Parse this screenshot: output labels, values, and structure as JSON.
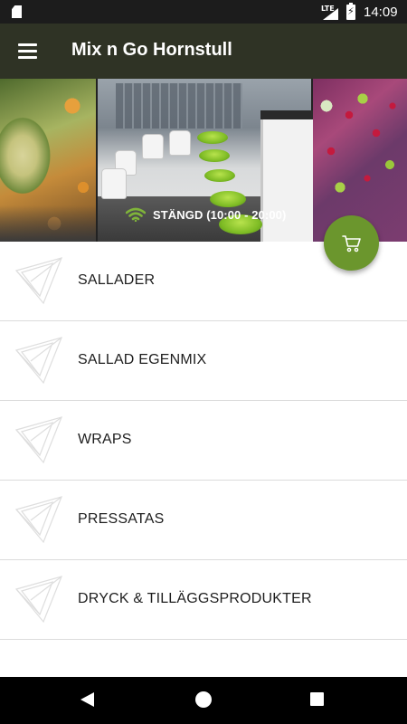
{
  "status_bar": {
    "network": "LTE",
    "time": "14:09",
    "icons": [
      "sd-card-icon",
      "signal-icon",
      "battery-charging-icon"
    ]
  },
  "app_bar": {
    "title": "Mix n Go Hornstull",
    "menu_icon": "hamburger-menu-icon"
  },
  "hero": {
    "status_text": "STÄNGD (10:00 - 20:00)",
    "status_icon": "wifi-icon",
    "status_icon_color": "#7fb43a"
  },
  "fab": {
    "icon": "shopping-cart-icon",
    "color": "#6b962d"
  },
  "menu": {
    "items": [
      {
        "label": "SALLADER"
      },
      {
        "label": "SALLAD EGENMIX"
      },
      {
        "label": "WRAPS"
      },
      {
        "label": "PRESSATAS"
      },
      {
        "label": "DRYCK & TILLÄGGSPRODUKTER"
      }
    ]
  },
  "nav_bar": {
    "icons": [
      "back-icon",
      "home-icon",
      "recent-apps-icon"
    ]
  },
  "colors": {
    "app_bar": "#2f3325",
    "status_bar": "#1c1c1c",
    "accent": "#6b962d"
  }
}
